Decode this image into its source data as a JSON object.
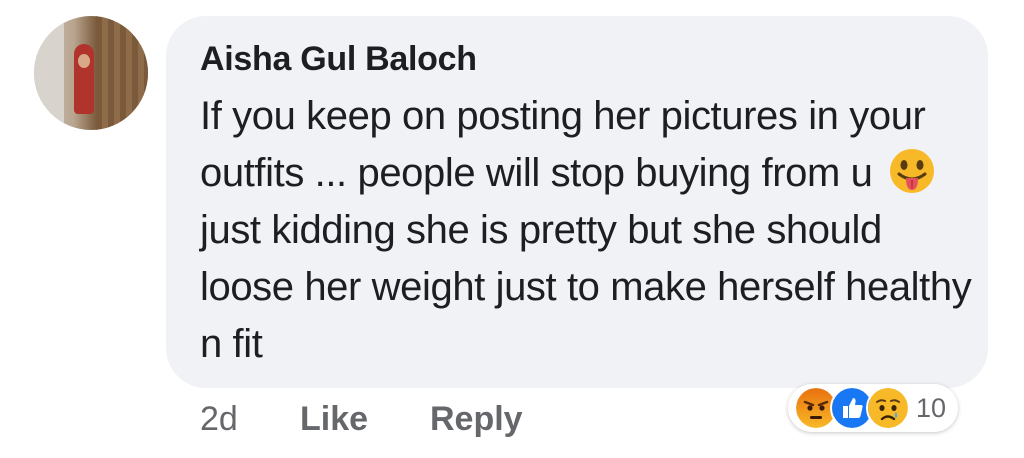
{
  "comment": {
    "author": "Aisha Gul Baloch",
    "text_part1": "If you keep on posting her pictures in your outfits ... people will stop buying from u",
    "emoji": "tongue-out-emoji",
    "text_part2": "just kidding she is pretty but she should loose her weight just to make herself healthy n fit",
    "timestamp": "2d",
    "like_label": "Like",
    "reply_label": "Reply",
    "reactions": {
      "icons": [
        "angry-reaction-icon",
        "like-reaction-icon",
        "sad-reaction-icon"
      ],
      "count": "10"
    }
  },
  "colors": {
    "bubble": "#f0f2f5",
    "text": "#1c1e21",
    "secondary_text": "#65676b",
    "like_blue": "#1877f2",
    "angry_orange": "#e9710f",
    "emoji_yellow": "#f7b928"
  }
}
